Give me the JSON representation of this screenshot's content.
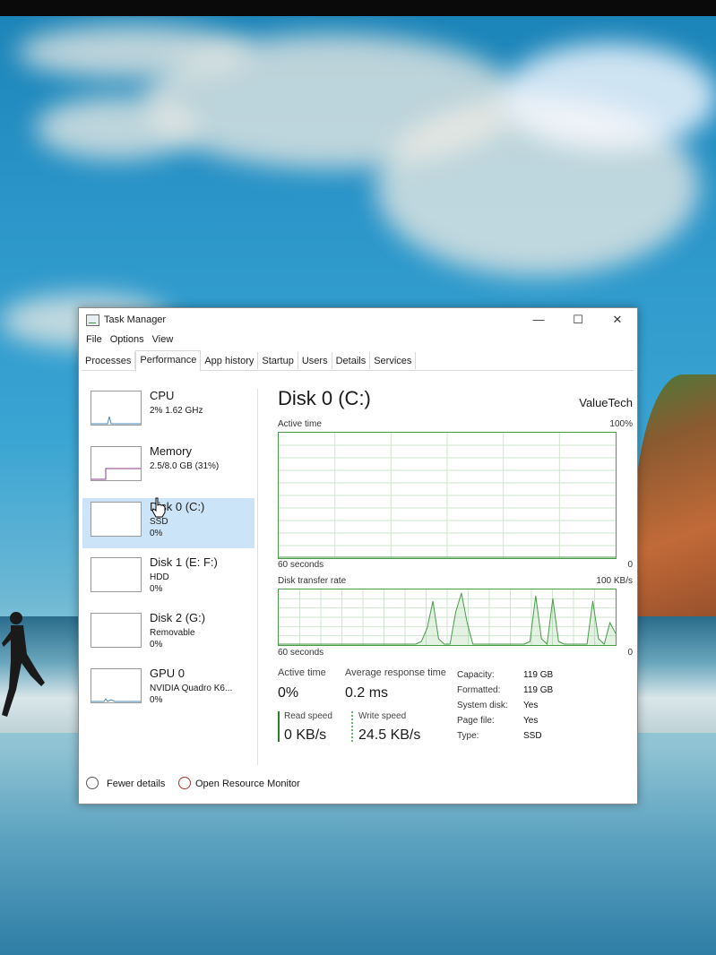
{
  "window": {
    "title": "Task Manager",
    "controls": {
      "minimize": "—",
      "maximize": "☐",
      "close": "✕"
    }
  },
  "menu": [
    "File",
    "Options",
    "View"
  ],
  "tabs": [
    "Processes",
    "Performance",
    "App history",
    "Startup",
    "Users",
    "Details",
    "Services"
  ],
  "active_tab": "Performance",
  "sidebar": {
    "items": [
      {
        "title": "CPU",
        "sub": "2% 1.62 GHz",
        "sub2": ""
      },
      {
        "title": "Memory",
        "sub": "2.5/8.0 GB (31%)",
        "sub2": ""
      },
      {
        "title": "Disk 0 (C:)",
        "sub": "SSD",
        "sub2": "0%"
      },
      {
        "title": "Disk 1 (E: F:)",
        "sub": "HDD",
        "sub2": "0%"
      },
      {
        "title": "Disk 2 (G:)",
        "sub": "Removable",
        "sub2": "0%"
      },
      {
        "title": "GPU 0",
        "sub": "NVIDIA Quadro K6...",
        "sub2": "0%"
      }
    ],
    "selected": "Disk 0 (C:)"
  },
  "main": {
    "title": "Disk 0 (C:)",
    "vendor": "ValueTech",
    "active_time_label": "Active time",
    "active_time_max": "100%",
    "seconds_label": "60 seconds",
    "zero_label": "0",
    "transfer_label": "Disk transfer rate",
    "transfer_max": "100 KB/s",
    "seconds_label_2": "60 seconds",
    "zero_label_2": "0"
  },
  "stats": {
    "active_time_label": "Active time",
    "active_time_value": "0%",
    "response_label": "Average response time",
    "response_value": "0.2 ms",
    "read_label": "Read speed",
    "read_value": "0 KB/s",
    "write_label": "Write speed",
    "write_value": "24.5 KB/s"
  },
  "properties": [
    {
      "label": "Capacity:",
      "value": "119 GB"
    },
    {
      "label": "Formatted:",
      "value": "119 GB"
    },
    {
      "label": "System disk:",
      "value": "Yes"
    },
    {
      "label": "Page file:",
      "value": "Yes"
    },
    {
      "label": "Type:",
      "value": "SSD"
    }
  ],
  "footer": {
    "fewer_details": "Fewer details",
    "resource_monitor": "Open Resource Monitor"
  },
  "colors": {
    "accent_green": "#4a9a4a",
    "selected_bg": "#cce4f7",
    "read_bar": "#2e7d2e",
    "write_bar": "#6ab56a"
  },
  "chart_data": {
    "type": "line",
    "series": [
      {
        "name": "Active time",
        "ylim": [
          0,
          100
        ],
        "values": [
          0,
          0,
          0,
          0,
          0,
          0,
          0,
          0,
          0,
          0,
          0,
          0,
          0,
          0,
          0,
          0,
          0,
          0,
          0,
          0,
          0,
          0,
          0,
          0,
          0,
          0,
          0,
          0,
          0,
          0,
          0,
          0,
          0,
          0,
          0,
          0,
          0,
          0,
          0,
          0,
          0,
          0,
          0,
          0,
          0,
          0,
          0,
          0,
          0,
          0,
          0,
          0,
          0,
          0,
          0,
          0,
          0,
          0,
          0,
          0
        ]
      },
      {
        "name": "Disk transfer rate",
        "ylim": [
          0,
          100
        ],
        "unit": "KB/s",
        "values": [
          0,
          0,
          0,
          0,
          0,
          0,
          0,
          0,
          0,
          0,
          0,
          0,
          0,
          0,
          0,
          0,
          0,
          0,
          0,
          0,
          0,
          0,
          0,
          0,
          0,
          5,
          30,
          80,
          10,
          0,
          0,
          60,
          95,
          40,
          0,
          0,
          0,
          0,
          0,
          0,
          0,
          0,
          0,
          0,
          5,
          90,
          10,
          0,
          85,
          5,
          0,
          0,
          0,
          0,
          0,
          80,
          10,
          0,
          40,
          20
        ]
      }
    ]
  }
}
